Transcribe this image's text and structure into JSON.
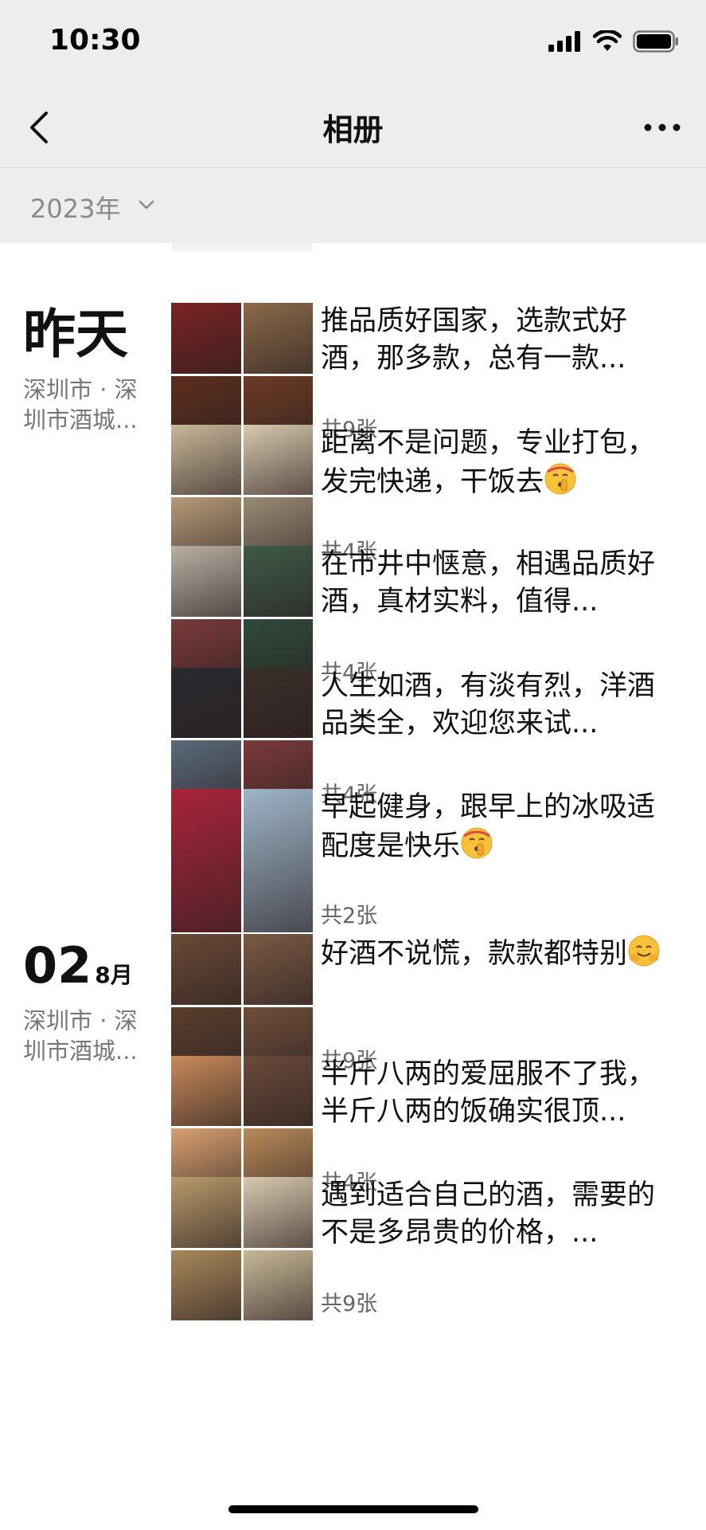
{
  "status": {
    "time": "10:30"
  },
  "nav": {
    "title": "相册"
  },
  "filter": {
    "year": "2023年"
  },
  "days": [
    {
      "day": "昨天",
      "month": "",
      "location": "深圳市 · 深圳市酒城...",
      "posts": [
        {
          "text": "推品质好国家，选款式好酒，那多款，总有一款...",
          "emoji": "",
          "count": "共9张",
          "layout": "g4",
          "colors": [
            "#7a2222",
            "#8a6a4a",
            "#5b2e1e",
            "#6b3a24"
          ]
        },
        {
          "text": "距离不是问题，专业打包，发完快递，干饭去",
          "emoji": "shush",
          "count": "共4张",
          "layout": "g4",
          "colors": [
            "#c9b79a",
            "#d8c8ae",
            "#b59a78",
            "#9a8a74"
          ]
        },
        {
          "text": "在市井中惬意，相遇品质好酒，真材实料，值得...",
          "emoji": "",
          "count": "共4张",
          "layout": "g4",
          "colors": [
            "#b9b0a4",
            "#3e5a48",
            "#7a3a3a",
            "#2f4a3a"
          ]
        },
        {
          "text": "人生如酒，有淡有烈，洋酒品类全，欢迎您来试...",
          "emoji": "",
          "count": "共4张",
          "layout": "g4",
          "colors": [
            "#2a2a30",
            "#3a2e2a",
            "#5a6a7a",
            "#7a3a3a"
          ]
        },
        {
          "text": "早起健身，跟早上的冰吸适配度是快乐",
          "emoji": "shush",
          "count": "共2张",
          "layout": "g2",
          "colors": [
            "#a8243a",
            "#9db4c8"
          ]
        }
      ]
    },
    {
      "day": "02",
      "month": "8月",
      "location": "深圳市 · 深圳市酒城...",
      "posts": [
        {
          "text": "好酒不说慌，款款都特别",
          "emoji": "hug",
          "count": "共9张",
          "layout": "g4",
          "colors": [
            "#6a4a36",
            "#7a5a44",
            "#5a3e2c",
            "#6e4e3a"
          ]
        },
        {
          "text": "半斤八两的爱屈服不了我，半斤八两的饭确实很顶...",
          "emoji": "",
          "count": "共4张",
          "layout": "g4",
          "colors": [
            "#c88a5a",
            "#6a4a3a",
            "#d8a070",
            "#b88a5a"
          ]
        },
        {
          "text": "遇到适合自己的酒，需要的不是多昂贵的价格，...",
          "emoji": "",
          "count": "共9张",
          "layout": "g4",
          "colors": [
            "#b89a6a",
            "#d8cab0",
            "#a8885a",
            "#c8b898"
          ]
        }
      ]
    }
  ]
}
